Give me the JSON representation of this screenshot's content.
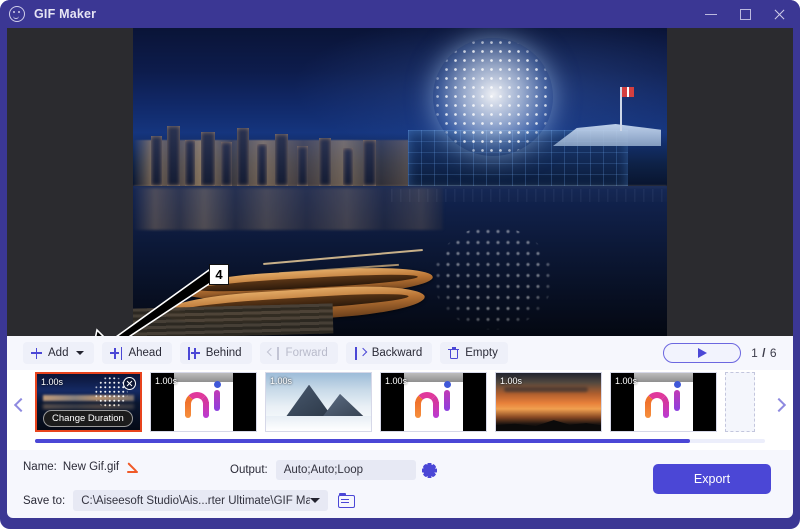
{
  "window": {
    "title": "GIF Maker",
    "app_icon": "gif-smiley-icon",
    "minimize_label": "Minimize",
    "maximize_label": "Maximize",
    "close_label": "Close",
    "accent_color": "#4b47d6",
    "titlebar_color": "#3b3794"
  },
  "annotation": {
    "marker": "4"
  },
  "toolbar": {
    "buttons": [
      {
        "label": "Add",
        "icon": "plus-icon",
        "has_caret": true,
        "disabled": false
      },
      {
        "label": "Ahead",
        "icon": "insert-ahead-icon",
        "disabled": false
      },
      {
        "label": "Behind",
        "icon": "insert-behind-icon",
        "disabled": false
      },
      {
        "label": "Forward",
        "icon": "move-forward-icon",
        "disabled": true
      },
      {
        "label": "Backward",
        "icon": "move-backward-icon",
        "disabled": false
      },
      {
        "label": "Empty",
        "icon": "trash-icon",
        "disabled": false
      }
    ],
    "play_label": "Play",
    "play_icon": "play-triangle-icon",
    "page_current": "1",
    "page_separator": "/",
    "page_total": "6"
  },
  "timeline": {
    "prev_label": "Previous frames",
    "next_label": "Next frames",
    "tooltip": "Change Duration",
    "close_label": "Remove frame",
    "frames": [
      {
        "duration": "1.00s",
        "art": "night-city",
        "selected": true,
        "tooltip": true
      },
      {
        "duration": "1.00s",
        "art": "ai-logo",
        "selected": false,
        "tooltip": false
      },
      {
        "duration": "1.00s",
        "art": "snow-peaks",
        "selected": false,
        "tooltip": false
      },
      {
        "duration": "1.00s",
        "art": "ai-logo",
        "selected": false,
        "tooltip": false
      },
      {
        "duration": "1.00s",
        "art": "sunset",
        "selected": false,
        "tooltip": false
      },
      {
        "duration": "1.00s",
        "art": "ai-logo",
        "selected": false,
        "tooltip": false
      }
    ]
  },
  "bottom": {
    "name_label": "Name:",
    "name_value": "New Gif.gif",
    "edit_icon": "pencil-icon",
    "output_label": "Output:",
    "output_value": "Auto;Auto;Loop",
    "settings_icon": "gear-icon",
    "save_label": "Save to:",
    "save_value": "C:\\Aiseesoft Studio\\Ais...rter Ultimate\\GIF Maker",
    "browse_icon": "folder-icon",
    "export_label": "Export"
  }
}
